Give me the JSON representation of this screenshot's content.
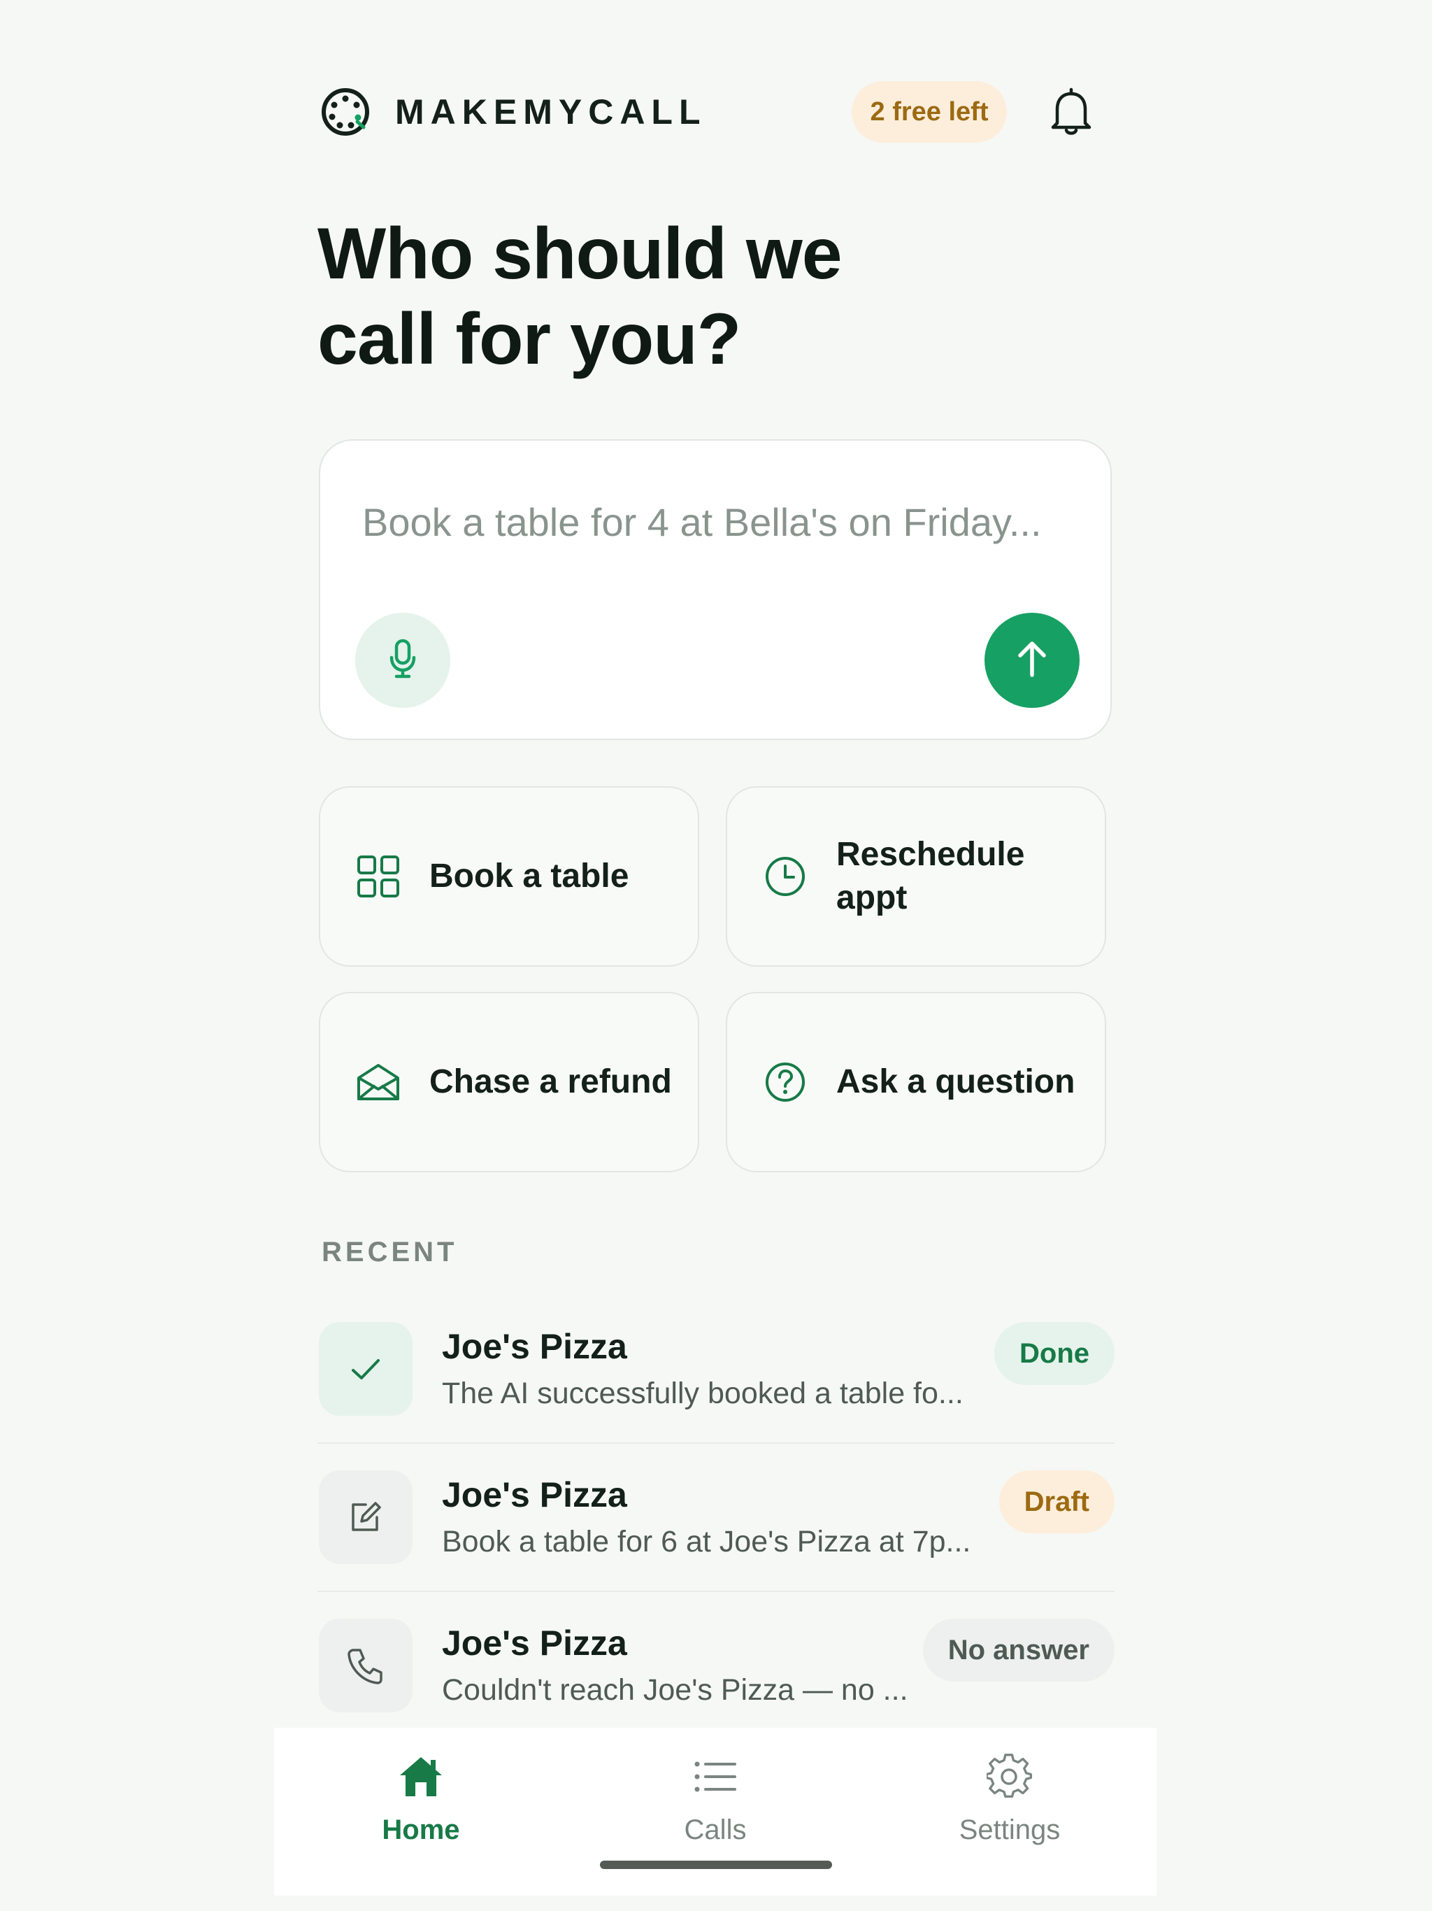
{
  "header": {
    "brand": "MAKEMYCALL",
    "free_badge": "2 free left",
    "icons": {
      "logo": "rotary-dial-icon",
      "notifications": "bell-icon"
    }
  },
  "hero": {
    "title_line1": "Who should we",
    "title_line2": "call for you?"
  },
  "composer": {
    "placeholder": "Book a table for 4 at Bella's on Friday...",
    "value": "",
    "icons": {
      "mic": "microphone-icon",
      "send": "arrow-up-icon"
    }
  },
  "quick_actions": [
    {
      "label": "Book a table",
      "icon": "grid-icon"
    },
    {
      "label": "Reschedule appt",
      "icon": "clock-icon"
    },
    {
      "label": "Chase a refund",
      "icon": "envelope-icon"
    },
    {
      "label": "Ask a question",
      "icon": "question-circle-icon"
    }
  ],
  "recent": {
    "heading": "RECENT",
    "items": [
      {
        "name": "Joe's Pizza",
        "description": "The AI successfully booked a table fo...",
        "status": "Done",
        "icon": "check-icon"
      },
      {
        "name": "Joe's Pizza",
        "description": "Book a table for 6 at Joe's Pizza at 7p...",
        "status": "Draft",
        "icon": "edit-icon"
      },
      {
        "name": "Joe's Pizza",
        "description": "Couldn't reach Joe's Pizza — no ...",
        "status": "No answer",
        "icon": "phone-icon"
      }
    ]
  },
  "nav": {
    "tabs": [
      {
        "label": "Home",
        "icon": "home-icon",
        "active": true
      },
      {
        "label": "Calls",
        "icon": "list-icon",
        "active": false
      },
      {
        "label": "Settings",
        "icon": "gear-icon",
        "active": false
      }
    ]
  },
  "colors": {
    "accent": "#16a063",
    "accent_dark": "#177a47",
    "background": "#f6f8f6",
    "done_bg": "#e5f3ec",
    "draft_bg": "#fdeedb",
    "draft_text": "#9c6a12",
    "neutral_bg": "#edf0ee"
  }
}
